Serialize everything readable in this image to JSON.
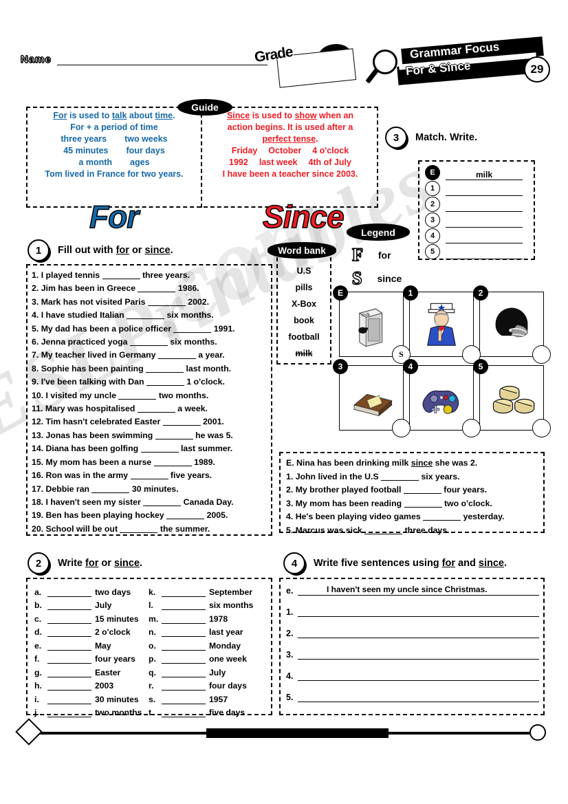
{
  "header": {
    "name_label": "Name",
    "grade_label": "Grade",
    "banner_line1": "Grammar Focus",
    "banner_line2": "For & Since",
    "banner_number": "29",
    "magnifier_icon": "magnifier-icon"
  },
  "guide": {
    "label": "Guide",
    "for_color": "#1568a8",
    "since_color": "#ed1c24",
    "for_title": "For",
    "since_title": "Since",
    "for_lines": {
      "l1_a": "For",
      "l1_b": " is used to ",
      "l1_c": "talk",
      "l1_d": " about ",
      "l1_e": "time",
      "l1_f": ".",
      "l2": "For + a period of time",
      "l3_a": "three years",
      "l3_b": "two weeks",
      "l4_a": "45 minutes",
      "l4_b": "four days",
      "l5_a": "a month",
      "l5_b": "ages",
      "l6": "Tom lived in France for two years."
    },
    "since_lines": {
      "l1_a": "Since",
      "l1_b": " is used to ",
      "l1_c": "show",
      "l1_d": " when an",
      "l2": "action begins. It is used after a",
      "l3": "perfect tense",
      "l3_end": ".",
      "l4_a": "Friday",
      "l4_b": "October",
      "l4_c": "4 o'clock",
      "l5_a": "1992",
      "l5_b": "last week",
      "l5_c": "4th of July",
      "l6": "I have been a teacher since 2003."
    }
  },
  "exercise1": {
    "number": "1",
    "title_a": "Fill out with ",
    "title_for": "for",
    "title_b": " or ",
    "title_since": "since",
    "title_c": ".",
    "items": [
      {
        "n": "1.",
        "pre": "I played tennis",
        "post": "three years."
      },
      {
        "n": "2.",
        "pre": "Jim has been in Greece",
        "post": "1986."
      },
      {
        "n": "3.",
        "pre": "Mark has not visited Paris",
        "post": "2002."
      },
      {
        "n": "4.",
        "pre": "I have studied Italian",
        "post": "six months."
      },
      {
        "n": "5.",
        "pre": "My dad has been a police officer",
        "post": "1991."
      },
      {
        "n": "6.",
        "pre": "Jenna practiced yoga",
        "post": "six months."
      },
      {
        "n": "7.",
        "pre": "My teacher lived in Germany",
        "post": "a year."
      },
      {
        "n": "8.",
        "pre": "Sophie has been painting",
        "post": "last month."
      },
      {
        "n": "9.",
        "pre": "I've been talking with Dan",
        "post": "1 o'clock."
      },
      {
        "n": "10.",
        "pre": "I visited my uncle",
        "post": "two months."
      },
      {
        "n": "11.",
        "pre": "Mary was hospitalised",
        "post": "a week."
      },
      {
        "n": "12.",
        "pre": "Tim hasn't celebrated Easter",
        "post": "2001."
      },
      {
        "n": "13.",
        "pre": "Jonas has been swimming",
        "post": "he was 5."
      },
      {
        "n": "14.",
        "pre": "Diana has been golfing",
        "post": "last summer."
      },
      {
        "n": "15.",
        "pre": "My mom has been a nurse",
        "post": "1989."
      },
      {
        "n": "16.",
        "pre": "Ron was in the army",
        "post": "five years."
      },
      {
        "n": "17.",
        "pre": "Debbie ran",
        "post": "30 minutes."
      },
      {
        "n": "18.",
        "pre": "I haven't seen my sister",
        "post": "Canada Day."
      },
      {
        "n": "19.",
        "pre": "Ben has been playing hockey",
        "post": "2005."
      },
      {
        "n": "20.",
        "pre": "School will be out",
        "post": "the summer."
      }
    ]
  },
  "word_bank": {
    "label": "Word bank",
    "items": [
      {
        "text": "U.S",
        "struck": false
      },
      {
        "text": "pills",
        "struck": false
      },
      {
        "text": "X-Box",
        "struck": false
      },
      {
        "text": "book",
        "struck": false
      },
      {
        "text": "football",
        "struck": false
      },
      {
        "text": "milk",
        "struck": true
      }
    ]
  },
  "legend": {
    "label": "Legend",
    "rows": [
      {
        "letter": "F",
        "meaning": "for"
      },
      {
        "letter": "S",
        "meaning": "since"
      }
    ]
  },
  "exercise3": {
    "number": "3",
    "title": "Match. Write.",
    "match_rows": [
      {
        "mark": "E",
        "filled": true,
        "answer": "milk"
      },
      {
        "mark": "1",
        "filled": false,
        "answer": ""
      },
      {
        "mark": "2",
        "filled": false,
        "answer": ""
      },
      {
        "mark": "3",
        "filled": false,
        "answer": ""
      },
      {
        "mark": "4",
        "filled": false,
        "answer": ""
      },
      {
        "mark": "5",
        "filled": false,
        "answer": ""
      }
    ],
    "pictures": [
      {
        "tag": "E",
        "answer": "S",
        "icon": "milk-carton-icon"
      },
      {
        "tag": "1",
        "answer": "",
        "icon": "uncle-sam-icon"
      },
      {
        "tag": "2",
        "answer": "",
        "icon": "football-helmet-icon"
      },
      {
        "tag": "3",
        "answer": "",
        "icon": "book-icon"
      },
      {
        "tag": "4",
        "answer": "",
        "icon": "game-controller-icon"
      },
      {
        "tag": "5",
        "answer": "",
        "icon": "pills-icon"
      }
    ],
    "sentences": [
      {
        "n": "E.",
        "pre": "Nina has been drinking milk",
        "mid": "since",
        "post": "she was 2.",
        "example": true
      },
      {
        "n": "1.",
        "pre": "John lived in the U.S",
        "post": "six years."
      },
      {
        "n": "2.",
        "pre": "My brother played football",
        "post": "four years."
      },
      {
        "n": "3.",
        "pre": "My mom has been reading",
        "post": "two o'clock."
      },
      {
        "n": "4.",
        "pre": "He's been playing video games",
        "post": "yesterday."
      },
      {
        "n": "5.",
        "pre": "Marcus was sick",
        "post": "three days."
      }
    ]
  },
  "exercise2": {
    "number": "2",
    "title_a": "Write ",
    "title_for": "for",
    "title_b": " or ",
    "title_since": "since",
    "title_c": ".",
    "col_left": [
      {
        "key": "a.",
        "value": "two days"
      },
      {
        "key": "b.",
        "value": "July"
      },
      {
        "key": "c.",
        "value": "15 minutes"
      },
      {
        "key": "d.",
        "value": "2 o'clock"
      },
      {
        "key": "e.",
        "value": "May"
      },
      {
        "key": "f.",
        "value": "four years"
      },
      {
        "key": "g.",
        "value": "Easter"
      },
      {
        "key": "h.",
        "value": "2003"
      },
      {
        "key": "i.",
        "value": "30 minutes"
      },
      {
        "key": "j.",
        "value": "two months"
      }
    ],
    "col_right": [
      {
        "key": "k.",
        "value": "September"
      },
      {
        "key": "l.",
        "value": "six months"
      },
      {
        "key": "m.",
        "value": "1978"
      },
      {
        "key": "n.",
        "value": "last year"
      },
      {
        "key": "o.",
        "value": "Monday"
      },
      {
        "key": "p.",
        "value": "one week"
      },
      {
        "key": "q.",
        "value": "July"
      },
      {
        "key": "r.",
        "value": "four days"
      },
      {
        "key": "s.",
        "value": "1957"
      },
      {
        "key": "t.",
        "value": "five days"
      }
    ]
  },
  "exercise4": {
    "number": "4",
    "title_a": "Write five sentences using ",
    "title_for": "for",
    "title_b": " and ",
    "title_since": "since",
    "title_c": ".",
    "rows": [
      {
        "key": "e.",
        "value": "I haven't seen my uncle since Christmas."
      },
      {
        "key": "1.",
        "value": ""
      },
      {
        "key": "2.",
        "value": ""
      },
      {
        "key": "3.",
        "value": ""
      },
      {
        "key": "4.",
        "value": ""
      },
      {
        "key": "5.",
        "value": ""
      }
    ]
  },
  "watermark": {
    "text": "ESLPrintables",
    "text2": ".com"
  }
}
